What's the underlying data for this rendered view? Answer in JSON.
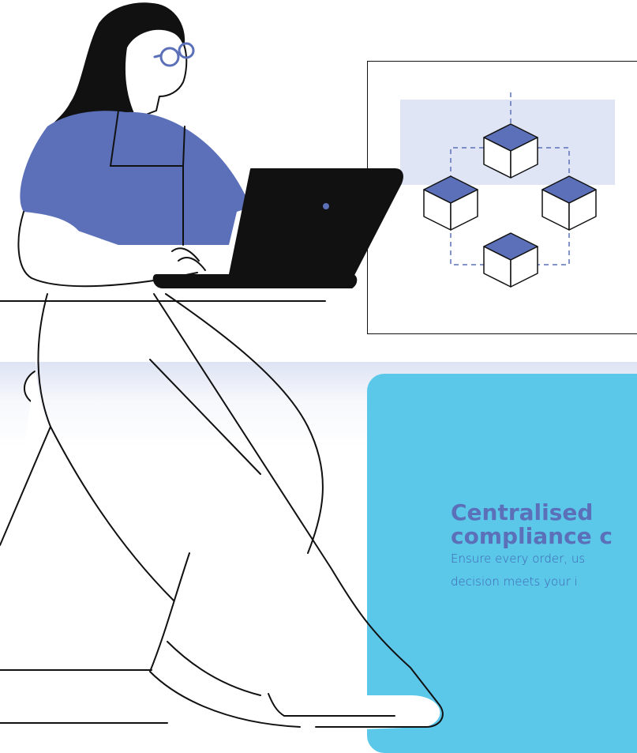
{
  "feature_card": {
    "title": "Centralised\ncompliance c",
    "description": "Ensure every order, us\ndecision meets your i"
  },
  "colors": {
    "accent_blue": "#5b70b8",
    "card_background": "#5bc8ea",
    "highlight": "#dfe5f5",
    "ink": "#111111"
  },
  "illustration": {
    "person": "woman-with-laptop-illustration",
    "diagram": "blockchain-network-illustration"
  }
}
